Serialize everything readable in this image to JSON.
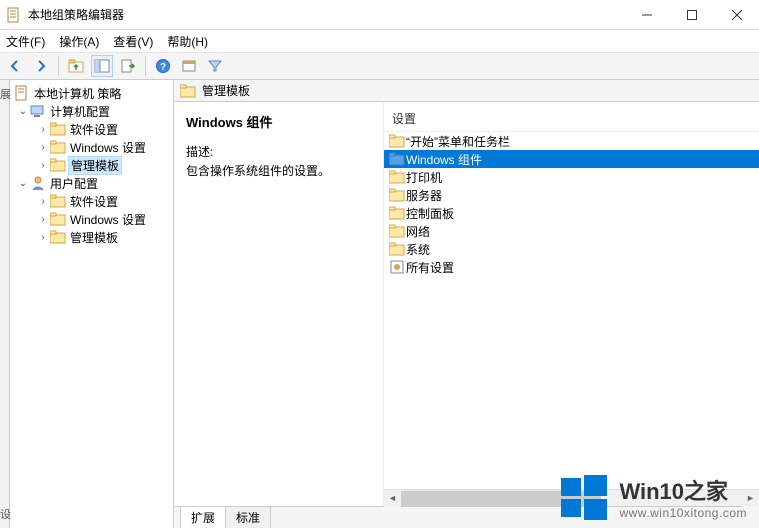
{
  "window": {
    "title": "本地组策略编辑器"
  },
  "menu": {
    "file": "文件(F)",
    "action": "操作(A)",
    "view": "查看(V)",
    "help": "帮助(H)"
  },
  "tree": {
    "root": "本地计算机 策略",
    "computer": "计算机配置",
    "user": "用户配置",
    "soft": "软件设置",
    "win": "Windows 设置",
    "admin": "管理模板"
  },
  "path": {
    "label": "管理模板"
  },
  "desc": {
    "heading": "Windows 组件",
    "label": "描述:",
    "text": "包含操作系统组件的设置。"
  },
  "list": {
    "header": "设置",
    "items": [
      "“开始”菜单和任务栏",
      "Windows 组件",
      "打印机",
      "服务器",
      "控制面板",
      "网络",
      "系统",
      "所有设置"
    ]
  },
  "tabs": {
    "ext": "扩展",
    "std": "标准"
  },
  "sidestrip": {
    "top": "展",
    "bottom": "设"
  },
  "watermark": {
    "brand_en": "Win10",
    "brand_zh": "之家",
    "url": "www.win10xitong.com"
  }
}
